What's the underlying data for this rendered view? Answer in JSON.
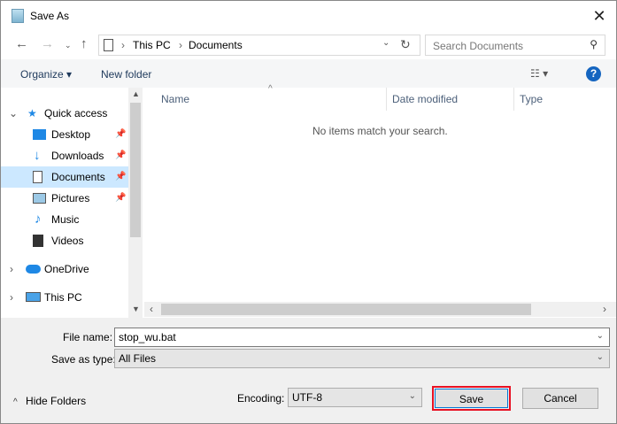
{
  "window": {
    "title": "Save As"
  },
  "address": {
    "crumbs": [
      "This PC",
      "Documents"
    ],
    "search_placeholder": "Search Documents"
  },
  "toolbar": {
    "organize": "Organize",
    "new_folder": "New folder"
  },
  "nav": {
    "items": [
      {
        "label": "Quick access",
        "icon": "star-icon"
      },
      {
        "label": "Desktop",
        "icon": "desktop-icon",
        "pinned": true
      },
      {
        "label": "Downloads",
        "icon": "download-icon",
        "pinned": true
      },
      {
        "label": "Documents",
        "icon": "documents-icon",
        "pinned": true,
        "selected": true
      },
      {
        "label": "Pictures",
        "icon": "pictures-icon",
        "pinned": true
      },
      {
        "label": "Music",
        "icon": "music-icon"
      },
      {
        "label": "Videos",
        "icon": "videos-icon"
      },
      {
        "label": "OneDrive",
        "icon": "cloud-icon"
      },
      {
        "label": "This PC",
        "icon": "computer-icon"
      }
    ]
  },
  "content": {
    "columns": [
      "Name",
      "Date modified",
      "Type"
    ],
    "empty_message": "No items match your search."
  },
  "form": {
    "file_name_label": "File name:",
    "file_name": "stop_wu.bat",
    "type_label": "Save as type:",
    "type": "All Files",
    "encoding_label": "Encoding:",
    "encoding": "UTF-8"
  },
  "buttons": {
    "hide_folders": "Hide Folders",
    "save": "Save",
    "cancel": "Cancel"
  },
  "colors": {
    "selected": "#cce8ff",
    "highlight": "#e81123"
  }
}
